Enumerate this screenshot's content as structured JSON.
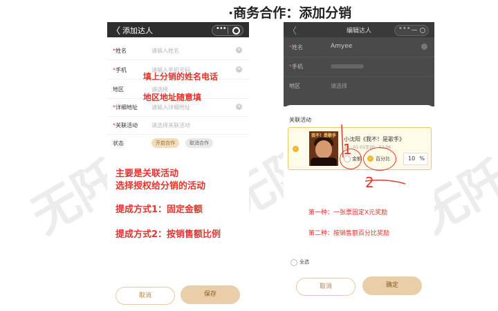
{
  "slide_title": "·商务合作：添加分销",
  "watermark": [
    "无阡",
    "无阡",
    "无阡"
  ],
  "left_phone": {
    "nav_title": "添加达人",
    "back_glyph": "〈",
    "capsule_dots": "•••",
    "fields": [
      {
        "label": "姓名",
        "required": "*",
        "placeholder": "请输入姓名",
        "clearable": true
      },
      {
        "label": "手机",
        "required": "*",
        "placeholder": "请输入手机号码",
        "clearable": true
      },
      {
        "label": "地区",
        "required": "",
        "placeholder": "请选择",
        "clearable": false
      },
      {
        "label": "详细地址",
        "required": "*",
        "placeholder": "请输入详细地址",
        "clearable": true
      },
      {
        "label": "关联活动",
        "required": "*",
        "placeholder": "请选择关联活动",
        "clearable": false
      }
    ],
    "status_label": "状态",
    "status_on": "开启合作",
    "status_off": "取消合作",
    "notes": {
      "name_phone": "填上分销的姓名电话",
      "region": "地区地址随意填",
      "main_1": "主要是关联活动",
      "main_2": "选择授权给分销的活动",
      "method_1": "提成方式1：固定金额",
      "method_2": "提成方式2：按销售额比例"
    },
    "cancel_button": "取消",
    "save_button": "保存"
  },
  "right_phone": {
    "nav_title": "编辑达人",
    "back_glyph": "〈",
    "capsule_dots": "•••",
    "bg_fields": [
      {
        "label": "姓名",
        "required": "*",
        "value": "Amyee"
      },
      {
        "label": "手机",
        "required": "*",
        "value": ""
      },
      {
        "label": "地区",
        "required": "",
        "value": "请选择"
      }
    ],
    "sheet_title": "关联活动",
    "activity": {
      "cover_text": "我不！是歌手",
      "name": "小沈阳《我不！是歌手》",
      "date": "20··-01-01至20··-02-06",
      "option_fixed": "金额",
      "option_percent": "百分比",
      "selected_option": "百分比",
      "percent_value": "10",
      "percent_unit": "%"
    },
    "annotations": {
      "one": "1",
      "two": "2"
    },
    "notes": {
      "first": "第一种：一张票固定X元奖励",
      "second": "第二种：按销售额百分比奖励"
    },
    "select_all": "全选",
    "cancel_button": "取消",
    "confirm_button": "确定"
  },
  "colors": {
    "accent_gold": "#e8cfa9",
    "annotation_red": "#e8322b",
    "check_gold": "#f1b52b"
  }
}
